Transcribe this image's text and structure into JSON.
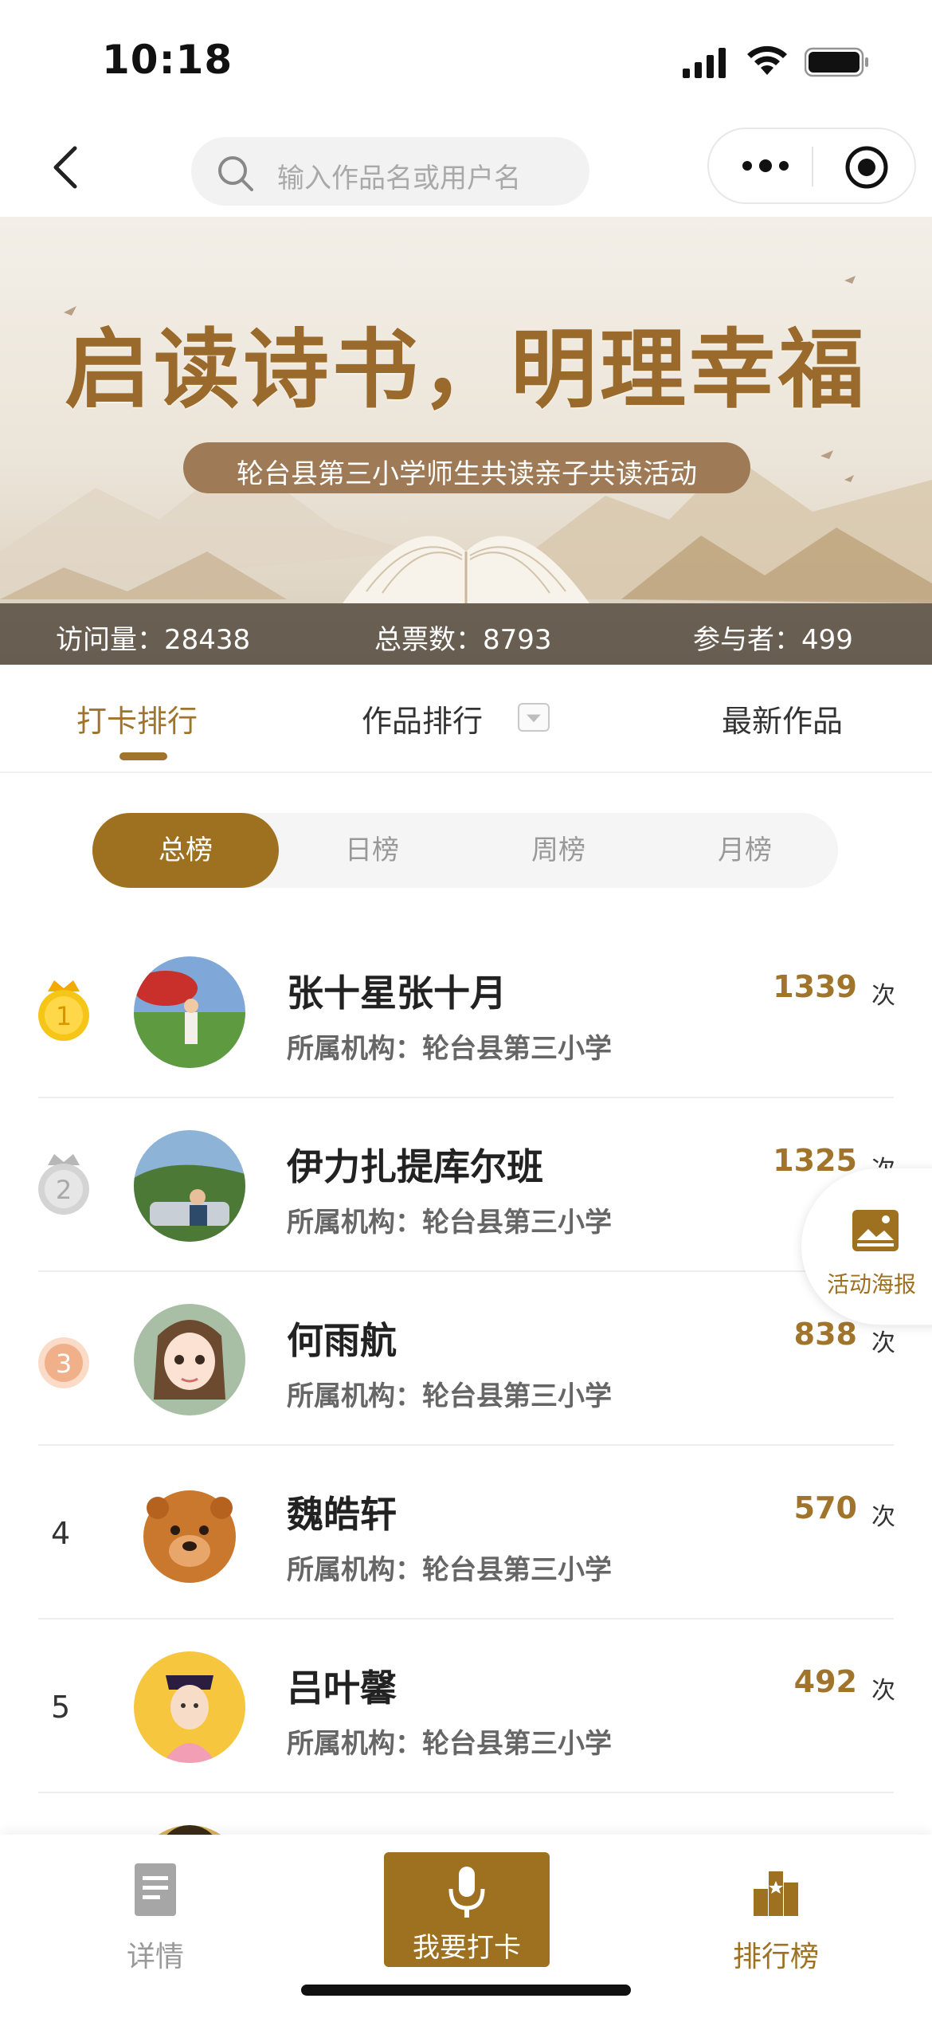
{
  "status_bar": {
    "time": "10:18"
  },
  "nav": {
    "search_placeholder": "输入作品名或用户名"
  },
  "banner": {
    "title": "启读诗书，明理幸福",
    "subtitle": "轮台县第三小学师生共读亲子共读活动",
    "stats": {
      "visits": "访问量：28438",
      "votes": "总票数：8793",
      "participants": "参与者：499"
    }
  },
  "tabs": [
    {
      "label": "打卡排行",
      "active": true
    },
    {
      "label": "作品排行",
      "active": false
    },
    {
      "label": "最新作品",
      "active": false
    }
  ],
  "segment": [
    "总榜",
    "日榜",
    "周榜",
    "月榜"
  ],
  "ranking": [
    {
      "rank": "1",
      "medal": "gold",
      "name": "张十星张十月",
      "org": "所属机构：轮台县第三小学",
      "count": "1339",
      "unit": "次"
    },
    {
      "rank": "2",
      "medal": "silver",
      "name": "伊力扎提库尔班",
      "org": "所属机构：轮台县第三小学",
      "count": "1325",
      "unit": "次"
    },
    {
      "rank": "3",
      "medal": "bronze",
      "name": "何雨航",
      "org": "所属机构：轮台县第三小学",
      "count": "838",
      "unit": "次"
    },
    {
      "rank": "4",
      "medal": "",
      "name": "魏皓轩",
      "org": "所属机构：轮台县第三小学",
      "count": "570",
      "unit": "次"
    },
    {
      "rank": "5",
      "medal": "",
      "name": "吕叶馨",
      "org": "所属机构：轮台县第三小学",
      "count": "492",
      "unit": "次"
    }
  ],
  "poster_button": {
    "label": "活动海报"
  },
  "bottom_bar": {
    "detail": "详情",
    "checkin": "我要打卡",
    "ranking": "排行榜"
  },
  "colors": {
    "accent": "#9e7121",
    "gold": "#f5c518",
    "silver": "#c8c8c8",
    "bronze": "#f0b08a"
  }
}
